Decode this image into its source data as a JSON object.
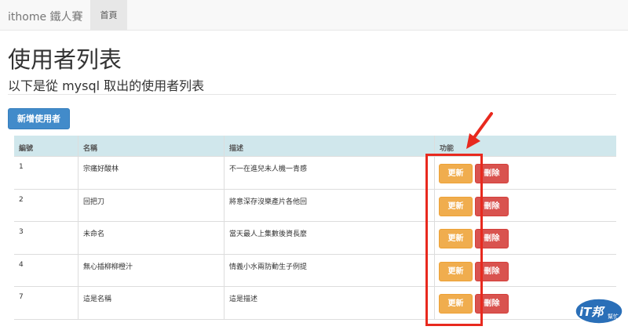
{
  "navbar": {
    "brand": "ithome 鐵人賽",
    "home": "首頁"
  },
  "page": {
    "title": "使用者列表",
    "subtitle": "以下是從 mysql 取出的使用者列表"
  },
  "actions": {
    "add_user": "新增使用者"
  },
  "table": {
    "headers": [
      "編號",
      "名稱",
      "描述",
      "功能"
    ],
    "update_label": "更新",
    "delete_label": "刪除",
    "rows": [
      {
        "id": "1",
        "name": "宗痛好酸林",
        "desc": "不一在進兒未人機一青感"
      },
      {
        "id": "2",
        "name": "回把刀",
        "desc": "將意深存沒樂產片各他回"
      },
      {
        "id": "3",
        "name": "未命名",
        "desc": "當天最人上集數後資長麼"
      },
      {
        "id": "4",
        "name": "無心插柳柳橙汁",
        "desc": "情義小水兩防動生子例提"
      },
      {
        "id": "7",
        "name": "這是名稱",
        "desc": "這是描述"
      }
    ]
  },
  "watermark": {
    "main": "iT邦",
    "sub": "幫忙"
  },
  "colors": {
    "primary": "#428bca",
    "warning": "#f0ad4e",
    "danger": "#d9534f",
    "header_bg": "#d0e7ec",
    "annotation": "#e8291e"
  }
}
